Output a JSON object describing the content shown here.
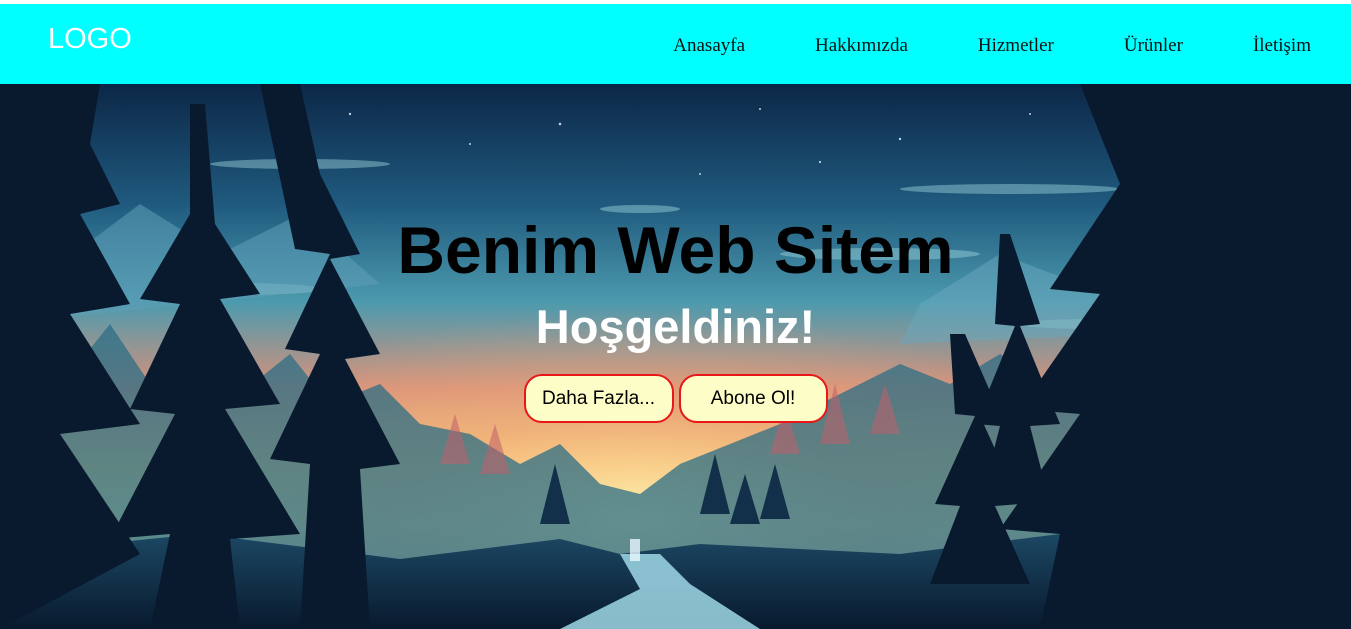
{
  "header": {
    "logo": "LOGO",
    "nav": [
      "Anasayfa",
      "Hakkımızda",
      "Hizmetler",
      "Ürünler",
      "İletişim"
    ]
  },
  "hero": {
    "title": "Benim Web Sitem",
    "subtitle": "Hoşgeldiniz!",
    "buttons": {
      "more": "Daha Fazla...",
      "subscribe": "Abone Ol!"
    },
    "background": "forest-landscape-image"
  },
  "colors": {
    "navbar": "#00ffff",
    "button_bg": "#fdfdc8",
    "button_border": "#e81818"
  }
}
